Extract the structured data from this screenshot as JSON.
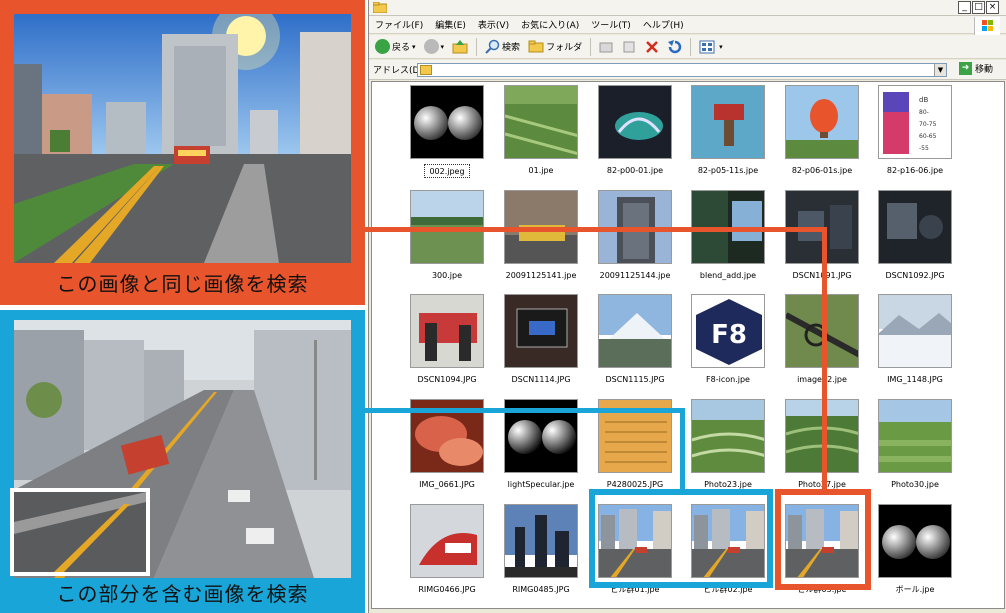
{
  "left_panels": {
    "top_caption": "この画像と同じ画像を検索",
    "bottom_caption": "この部分を含む画像を検索"
  },
  "window": {
    "menu": [
      "ファイル(F)",
      "編集(E)",
      "表示(V)",
      "お気に入り(A)",
      "ツール(T)",
      "ヘルプ(H)"
    ],
    "toolbar": {
      "back_label": "戻る",
      "search_label": "検索",
      "folders_label": "フォルダ"
    },
    "address": {
      "label": "アドレス(D)",
      "value": "",
      "go_label": "移動"
    },
    "title_buttons": [
      "_",
      "□",
      "×"
    ]
  },
  "files": [
    {
      "name": "002.jpeg",
      "thumb": "spheres",
      "selected": true
    },
    {
      "name": "01.jpe",
      "thumb": "fields"
    },
    {
      "name": "82-p00-01.jpe",
      "thumb": "sculpture"
    },
    {
      "name": "82-p05-11s.jpe",
      "thumb": "robot"
    },
    {
      "name": "82-p06-01s.jpe",
      "thumb": "balloon"
    },
    {
      "name": "82-p16-06.jpe",
      "thumb": "legend"
    },
    {
      "name": "300.jpe",
      "thumb": "landscape"
    },
    {
      "name": "20091125141.jpe",
      "thumb": "taxi"
    },
    {
      "name": "20091125144.jpe",
      "thumb": "building"
    },
    {
      "name": "blend_add.jpe",
      "thumb": "blend"
    },
    {
      "name": "DSCN1091.JPG",
      "thumb": "dark-room"
    },
    {
      "name": "DSCN1092.JPG",
      "thumb": "dark-room2"
    },
    {
      "name": "DSCN1094.JPG",
      "thumb": "people"
    },
    {
      "name": "DSCN1114.JPG",
      "thumb": "monitor"
    },
    {
      "name": "DSCN1115.JPG",
      "thumb": "mountain"
    },
    {
      "name": "F8-icon.jpe",
      "thumb": "f8"
    },
    {
      "name": "image02.jpe",
      "thumb": "glasses"
    },
    {
      "name": "IMG_1148.JPG",
      "thumb": "snow"
    },
    {
      "name": "IMG_0661.JPG",
      "thumb": "food"
    },
    {
      "name": "lightSpecular.jpe",
      "thumb": "specular"
    },
    {
      "name": "P4280025.JPG",
      "thumb": "document"
    },
    {
      "name": "Photo23.jpe",
      "thumb": "terraces"
    },
    {
      "name": "Photo27.jpe",
      "thumb": "terraces2"
    },
    {
      "name": "Photo30.jpe",
      "thumb": "green-fields"
    },
    {
      "name": "RIMG0466.JPG",
      "thumb": "train"
    },
    {
      "name": "RIMG0485.JPG",
      "thumb": "dusk"
    },
    {
      "name": "ビル群01.jpe",
      "thumb": "city"
    },
    {
      "name": "ビル群02.jpe",
      "thumb": "city"
    },
    {
      "name": "ビル群03.jpe",
      "thumb": "city"
    },
    {
      "name": "ボール.jpe",
      "thumb": "spheres"
    }
  ],
  "colors": {
    "top_highlight": "#e8542c",
    "bottom_highlight": "#1aa5d8"
  }
}
